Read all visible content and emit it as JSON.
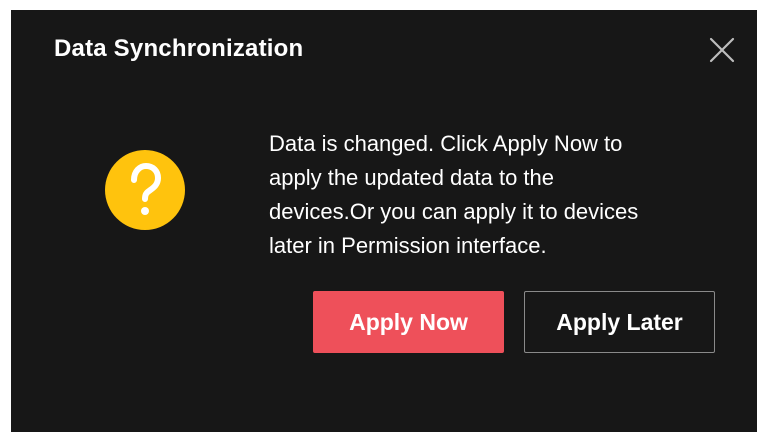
{
  "dialog": {
    "title": "Data Synchronization",
    "close_icon": "close-icon",
    "status_icon": "question-icon",
    "status_icon_color": "#ffc30d",
    "message_lines": [
      "Data is changed. Click Apply Now to",
      "apply the updated data to the",
      "devices.Or you can apply it to devices",
      "later in Permission interface."
    ],
    "buttons": {
      "apply_now": "Apply Now",
      "apply_later": "Apply Later"
    }
  },
  "colors": {
    "background": "#171717",
    "primary_button": "#ee505a",
    "secondary_border": "#8a8a8a",
    "text": "#ffffff"
  }
}
